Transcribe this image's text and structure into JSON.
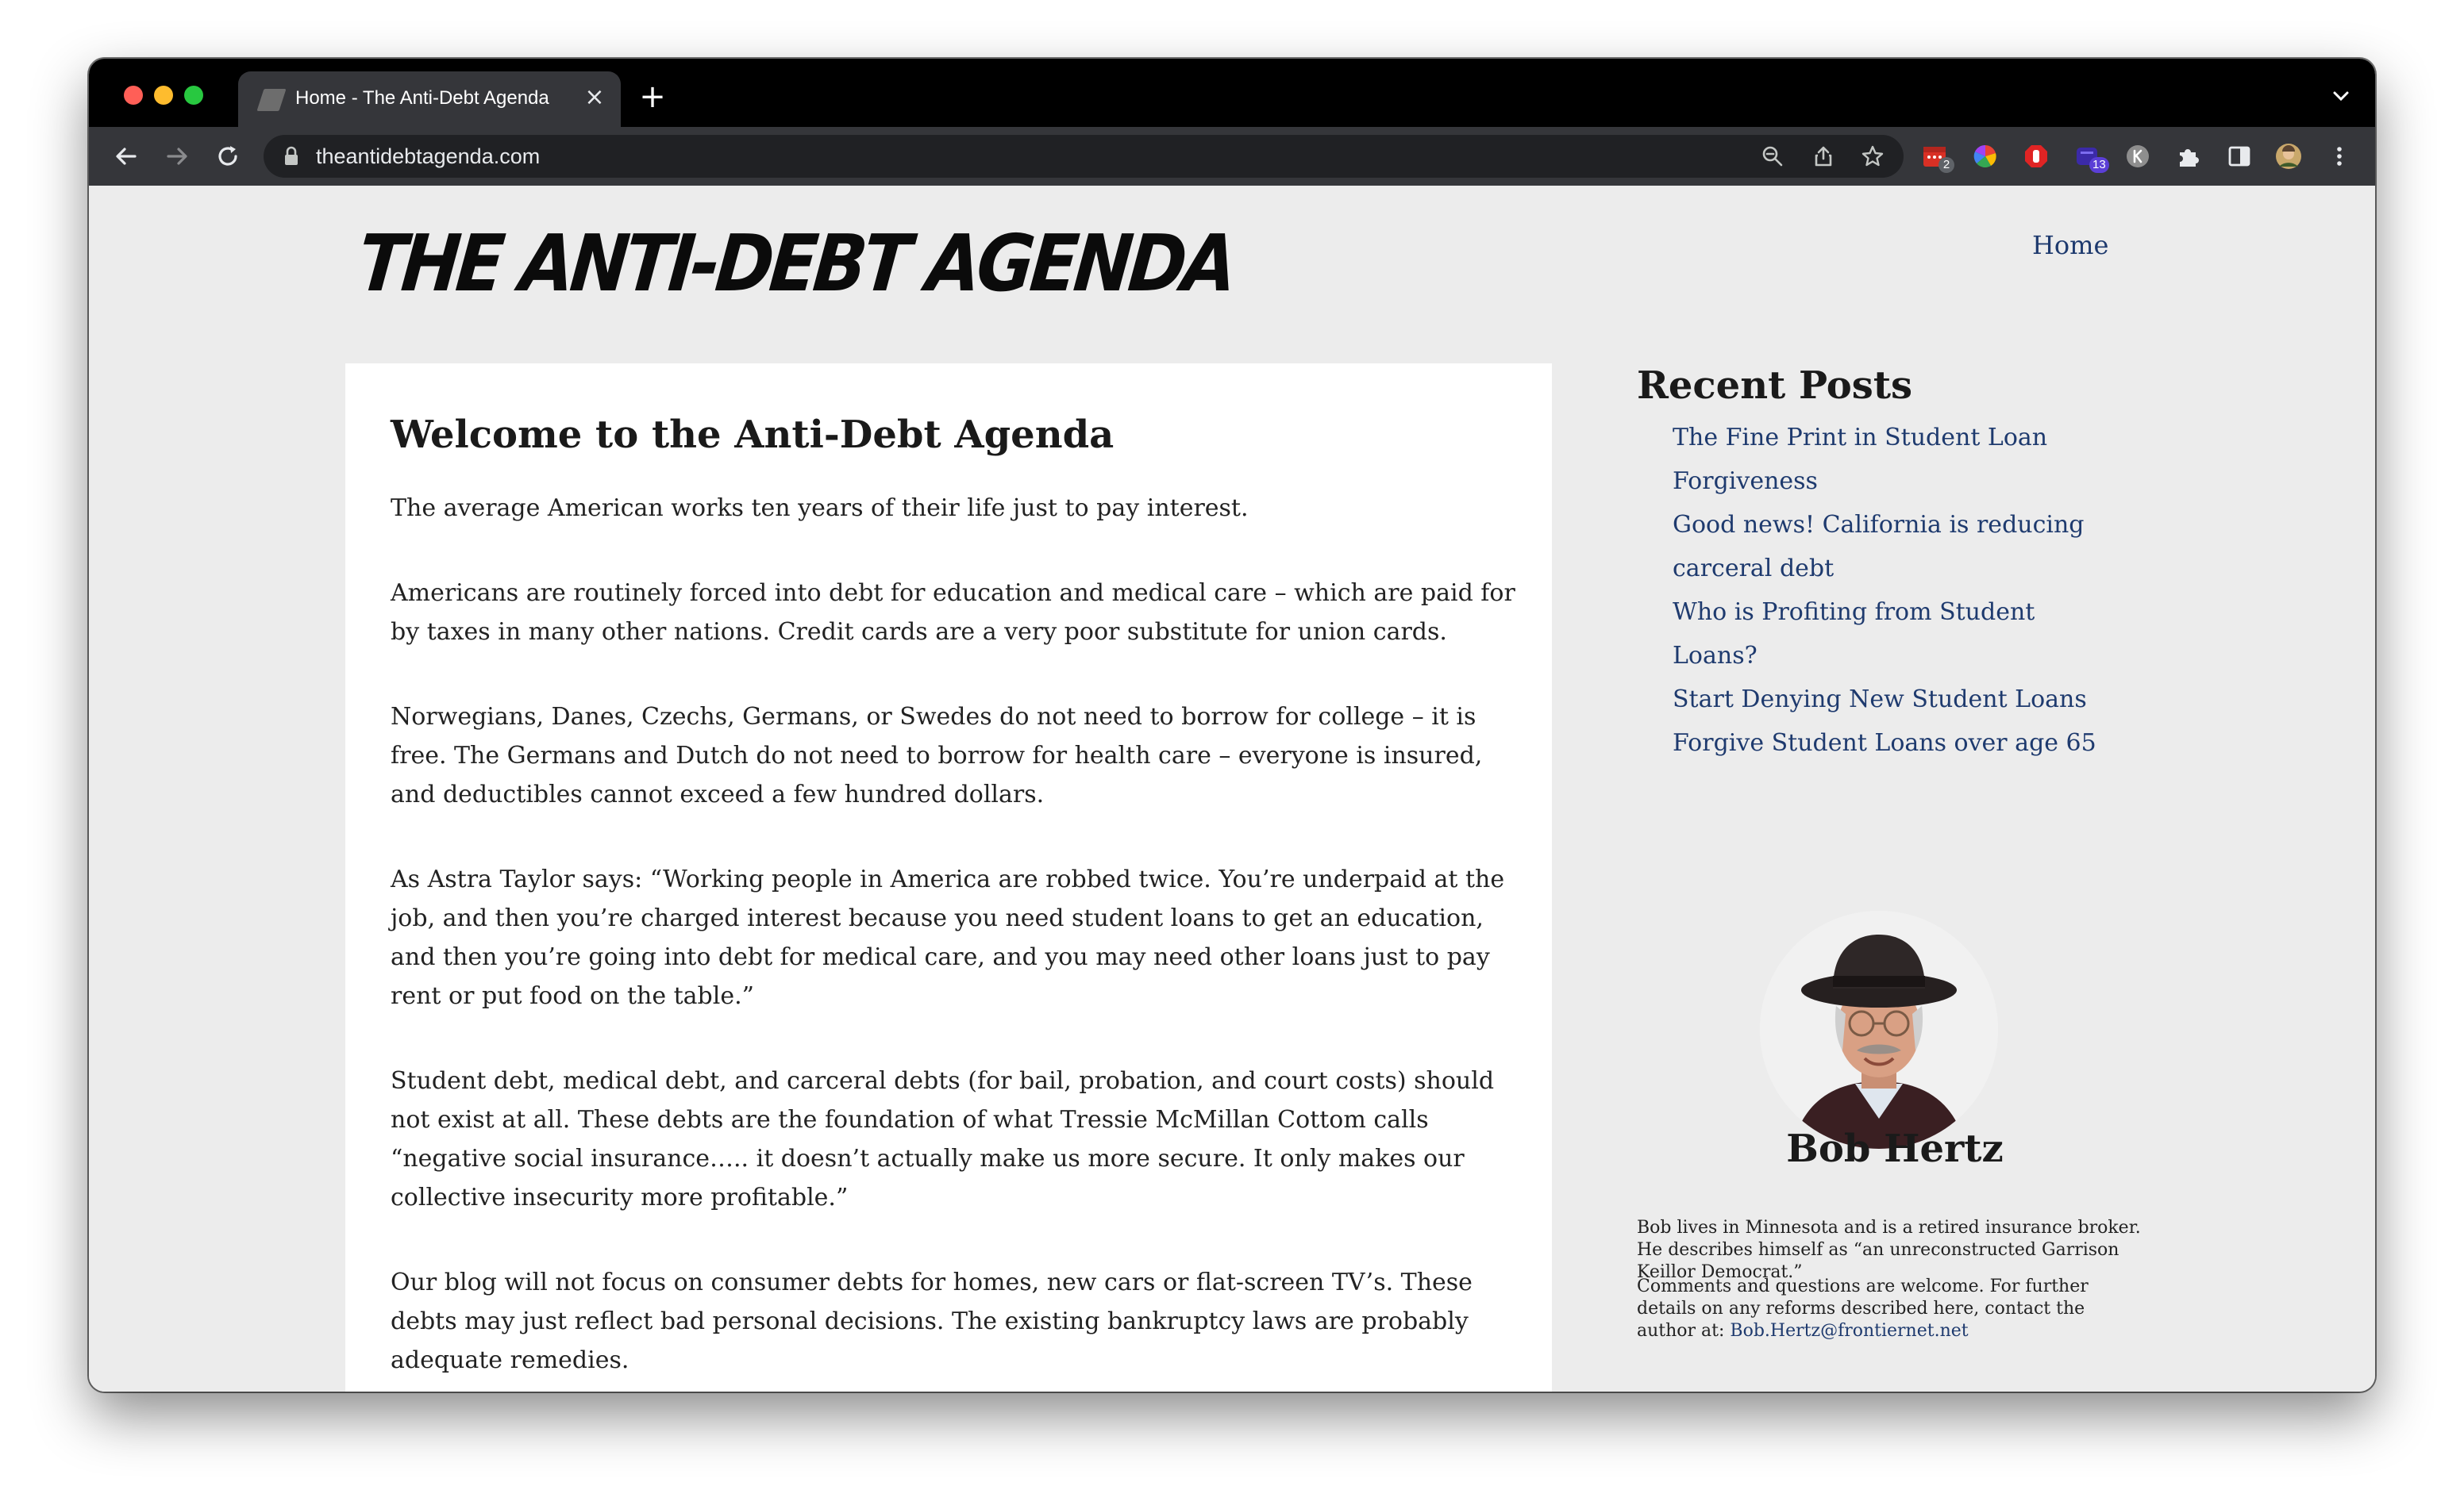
{
  "browser": {
    "tab_title": "Home - The Anti-Debt Agenda",
    "tab_close": "×",
    "new_tab": "+",
    "url": "theantidebtagenda.com",
    "extension_badges": [
      "2",
      "13"
    ]
  },
  "site": {
    "title": "THE ANTI-DEBT AGENDA",
    "nav_home": "Home"
  },
  "post": {
    "title": "Welcome to the Anti-Debt Agenda",
    "paragraphs": [
      "The average American works ten years of their life just to pay interest.",
      "Americans are routinely forced into debt for education and medical care – which are paid for by taxes  in many other nations. Credit cards are a very poor substitute for union cards.",
      "Norwegians, Danes, Czechs,  Germans, or Swedes do not need to borrow for college – it is free. The Germans and Dutch do not need to borrow for health care – everyone is insured, and deductibles cannot exceed a few hundred dollars.",
      "As Astra Taylor says: “Working people in America are robbed twice. You’re underpaid at the job, and then you’re charged interest because  you need student loans to get an education, and then you’re going into debt for medical care, and you may need other loans just to pay rent or put food on the table.”",
      "Student debt, medical debt, and carceral debts (for bail, probation, and court costs)  should not exist at all.  These debts are the foundation of what Tressie McMillan Cottom calls “negative social insurance…..  it doesn’t actually make us more secure. It only makes our collective insecurity more profitable.”",
      "Our blog will not focus on consumer debts for  homes, new cars or flat-screen TV’s. These debts may just reflect bad personal decisions. The existing bankruptcy laws are probably adequate remedies."
    ]
  },
  "sidebar": {
    "recent_title": "Recent Posts",
    "recent_posts": [
      "The Fine Print in Student Loan Forgiveness",
      "Good news! California is reducing carceral debt",
      "Who is Profiting from Student Loans?",
      "Start Denying New Student Loans",
      "Forgive Student Loans over age 65"
    ],
    "author_name": "Bob Hertz",
    "author_bio": "Bob lives in Minnesota and is a retired insurance broker. He describes himself as “an unreconstructed Garrison Keillor Democrat.”",
    "author_contact": "Comments and questions are welcome. For further details on any reforms described here, contact the author at: ",
    "author_email": "Bob.Hertz@frontiernet.net"
  }
}
